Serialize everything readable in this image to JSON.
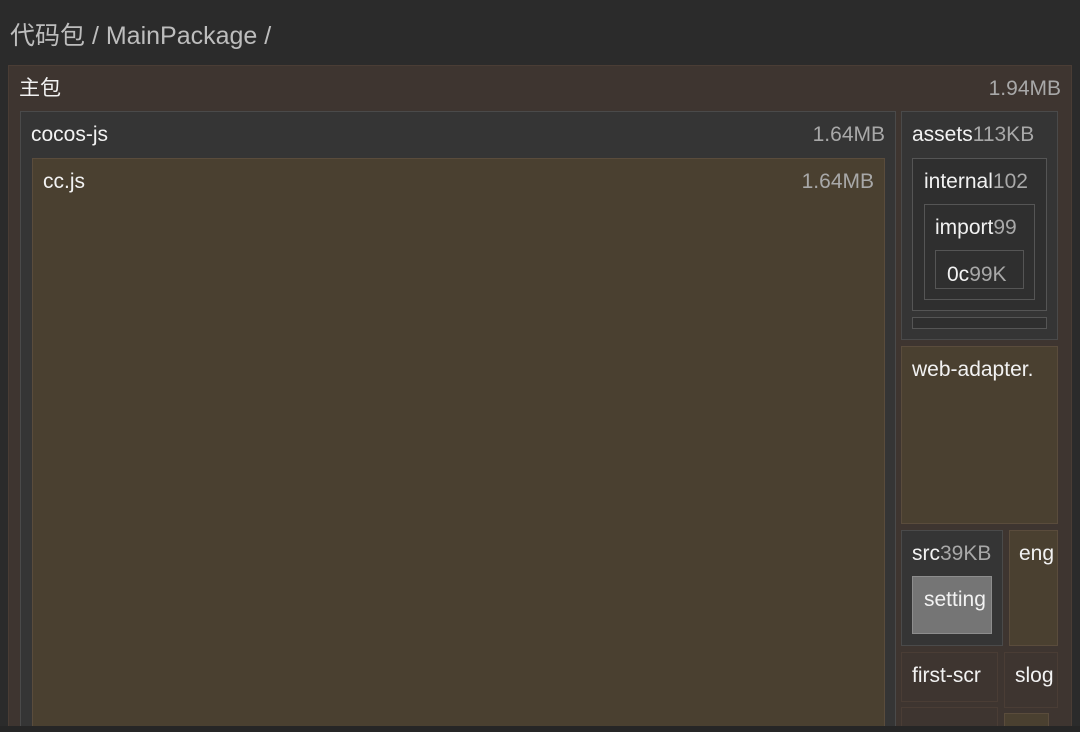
{
  "breadcrumb": {
    "text": "代码包 / MainPackage /"
  },
  "tree": {
    "root": {
      "label": "主包",
      "size": "1.94MB"
    },
    "cocos_js": {
      "label": "cocos-js",
      "size": "1.64MB"
    },
    "cc_js": {
      "label": "cc.js",
      "size": "1.64MB"
    },
    "assets": {
      "label": "assets",
      "size": "113KB"
    },
    "internal": {
      "label": "internal",
      "size": "102"
    },
    "import": {
      "label": "import",
      "size": "99"
    },
    "oc": {
      "label": "0c",
      "size": "99K"
    },
    "web_adapter": {
      "label": "web-adapter."
    },
    "src": {
      "label": "src",
      "size": "39KB"
    },
    "settings": {
      "label": "setting"
    },
    "eng": {
      "label": "eng"
    },
    "first_scr": {
      "label": "first-scr"
    },
    "slog": {
      "label": "slog"
    }
  }
}
